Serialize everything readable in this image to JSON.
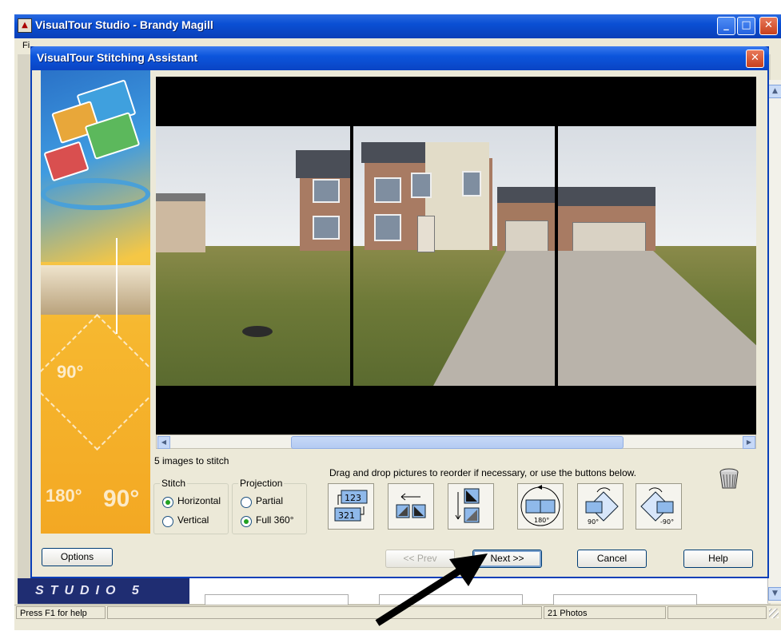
{
  "app": {
    "title": "VisualTour Studio - Brandy Magill",
    "menu_first": "Fi",
    "brand": "STUDIO 5",
    "status": {
      "help": "Press F1 for help",
      "photos": "21 Photos"
    }
  },
  "dialog": {
    "title": "VisualTour Stitching Assistant",
    "images_count": "5 images to stitch",
    "instructions": "Drag and drop pictures to reorder if necessary, or use the buttons below.",
    "stitch": {
      "label": "Stitch",
      "options": [
        "Horizontal",
        "Vertical"
      ],
      "selected": "Horizontal"
    },
    "projection": {
      "label": "Projection",
      "options": [
        "Partial",
        "Full 360°"
      ],
      "selected": "Full 360°"
    },
    "tools": {
      "reverse_order": "reverse-order",
      "move_left": "move-left",
      "flip": "flip",
      "rotate_180": "180°",
      "rotate_cw": "90°",
      "rotate_ccw": "-90°"
    },
    "buttons": {
      "options": "Options",
      "prev": "<< Prev",
      "next": "Next >>",
      "cancel": "Cancel",
      "help": "Help"
    }
  }
}
